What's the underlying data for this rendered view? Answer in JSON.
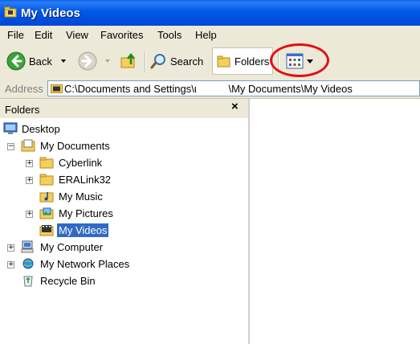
{
  "window": {
    "title": "My Videos"
  },
  "menu": [
    "File",
    "Edit",
    "View",
    "Favorites",
    "Tools",
    "Help"
  ],
  "toolbar": {
    "back_label": "Back",
    "search_label": "Search",
    "folders_label": "Folders"
  },
  "address": {
    "label": "Address",
    "path": "C:\\Documents and Settings\\ι           \\My Documents\\My Videos"
  },
  "folders_pane": {
    "title": "Folders",
    "close_glyph": "×",
    "items": [
      {
        "label": "Desktop",
        "icon": "desktop-icon",
        "expander": ""
      },
      {
        "label": "My Documents",
        "icon": "my-documents-icon",
        "expander": "−"
      },
      {
        "label": "Cyberlink",
        "icon": "folder-icon",
        "expander": "+"
      },
      {
        "label": "ERALink32",
        "icon": "folder-icon",
        "expander": "+"
      },
      {
        "label": "My Music",
        "icon": "music-folder-icon",
        "expander": ""
      },
      {
        "label": "My Pictures",
        "icon": "pictures-folder-icon",
        "expander": "+"
      },
      {
        "label": "My Videos",
        "icon": "videos-folder-icon",
        "expander": "",
        "selected": true
      },
      {
        "label": "My Computer",
        "icon": "computer-icon",
        "expander": "+"
      },
      {
        "label": "My Network Places",
        "icon": "network-icon",
        "expander": "+"
      },
      {
        "label": "Recycle Bin",
        "icon": "recycle-bin-icon",
        "expander": ""
      }
    ]
  },
  "colors": {
    "titlebar": "#0058e6",
    "chrome": "#ece9d8",
    "selection": "#316ac5",
    "annotation": "#e31010"
  }
}
